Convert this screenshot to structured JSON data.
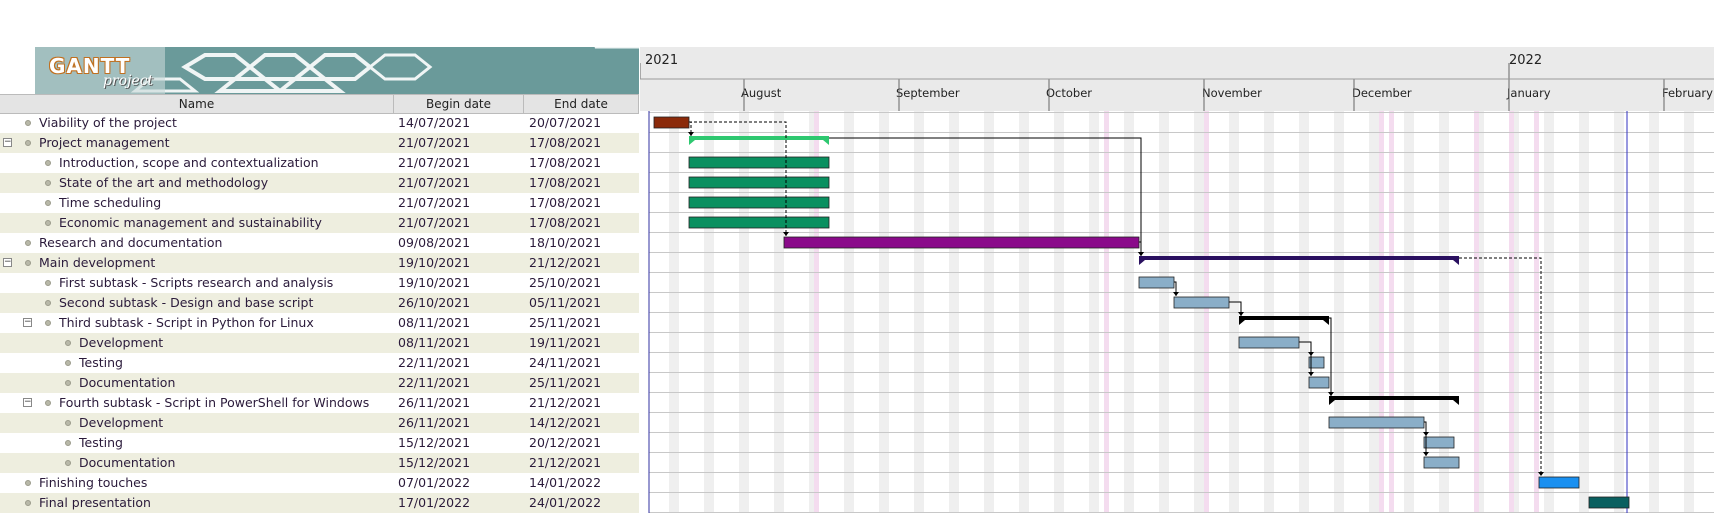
{
  "logo": {
    "text": "GANTT",
    "sub": "project"
  },
  "columns": {
    "name": "Name",
    "begin": "Begin date",
    "end": "End date"
  },
  "tasks": [
    {
      "name": "Viability of the project",
      "begin": "14/07/2021",
      "end": "20/07/2021"
    },
    {
      "name": "Project management",
      "begin": "21/07/2021",
      "end": "17/08/2021"
    },
    {
      "name": "Introduction, scope and contextualization",
      "begin": "21/07/2021",
      "end": "17/08/2021"
    },
    {
      "name": "State of the art and methodology",
      "begin": "21/07/2021",
      "end": "17/08/2021"
    },
    {
      "name": "Time scheduling",
      "begin": "21/07/2021",
      "end": "17/08/2021"
    },
    {
      "name": "Economic management and sustainability",
      "begin": "21/07/2021",
      "end": "17/08/2021"
    },
    {
      "name": "Research and documentation",
      "begin": "09/08/2021",
      "end": "18/10/2021"
    },
    {
      "name": "Main development",
      "begin": "19/10/2021",
      "end": "21/12/2021"
    },
    {
      "name": "First subtask - Scripts research and analysis",
      "begin": "19/10/2021",
      "end": "25/10/2021"
    },
    {
      "name": "Second subtask - Design and base script",
      "begin": "26/10/2021",
      "end": "05/11/2021"
    },
    {
      "name": "Third subtask - Script in Python for Linux",
      "begin": "08/11/2021",
      "end": "25/11/2021"
    },
    {
      "name": "Development",
      "begin": "08/11/2021",
      "end": "19/11/2021"
    },
    {
      "name": "Testing",
      "begin": "22/11/2021",
      "end": "24/11/2021"
    },
    {
      "name": "Documentation",
      "begin": "22/11/2021",
      "end": "25/11/2021"
    },
    {
      "name": "Fourth subtask - Script in PowerShell for Windows",
      "begin": "26/11/2021",
      "end": "21/12/2021"
    },
    {
      "name": "Development",
      "begin": "26/11/2021",
      "end": "14/12/2021"
    },
    {
      "name": "Testing",
      "begin": "15/12/2021",
      "end": "20/12/2021"
    },
    {
      "name": "Documentation",
      "begin": "15/12/2021",
      "end": "21/12/2021"
    },
    {
      "name": "Finishing touches",
      "begin": "07/01/2022",
      "end": "14/01/2022"
    },
    {
      "name": "Final presentation",
      "begin": "17/01/2022",
      "end": "24/01/2022"
    }
  ],
  "timeline": {
    "years": [
      "2021",
      "2022"
    ],
    "months": [
      "August",
      "September",
      "October",
      "November",
      "December",
      "January",
      "February"
    ]
  },
  "colors": {
    "viability": "#8b2a0a",
    "management": "#0a9060",
    "management_summary": "#2ec870",
    "research": "#8a0a8a",
    "main_summary": "#2a1060",
    "subtask": "#8aaec8",
    "subtask_summary": "#000000",
    "finishing": "#1a90f0",
    "final": "#0a6060"
  }
}
